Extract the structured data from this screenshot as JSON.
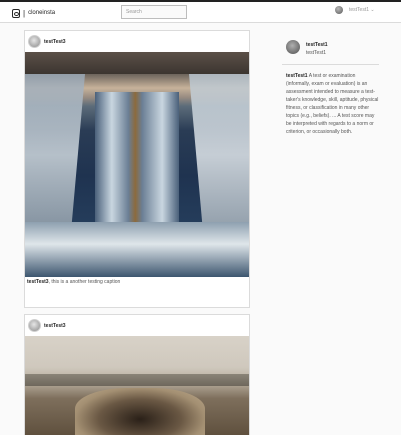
{
  "header": {
    "brand": "cloneinsta",
    "brand_separator": "|",
    "search_placeholder": "Search",
    "user_menu_label": "testTest1 ⌄"
  },
  "feed": [
    {
      "username": "testTest3",
      "photo_alt": "3D street art of a waterfall in a mall",
      "caption_user": "testTest3",
      "caption_text": ", this is a another testing caption"
    },
    {
      "username": "testTest3",
      "photo_alt": "3D street art of a canyon pit on a bridge"
    }
  ],
  "sidebar": {
    "username": "testTest1",
    "display_name": "testTest1",
    "bio_user": "testTest1",
    "bio_text": " A test or examination (informally, exam or evaluation) is an assessment intended to measure a test-taker's knowledge, skill, aptitude, physical fitness, or classification in many other topics (e.g., beliefs). ... A test score may be interpreted with regards to a norm or criterion, or occasionally both."
  }
}
